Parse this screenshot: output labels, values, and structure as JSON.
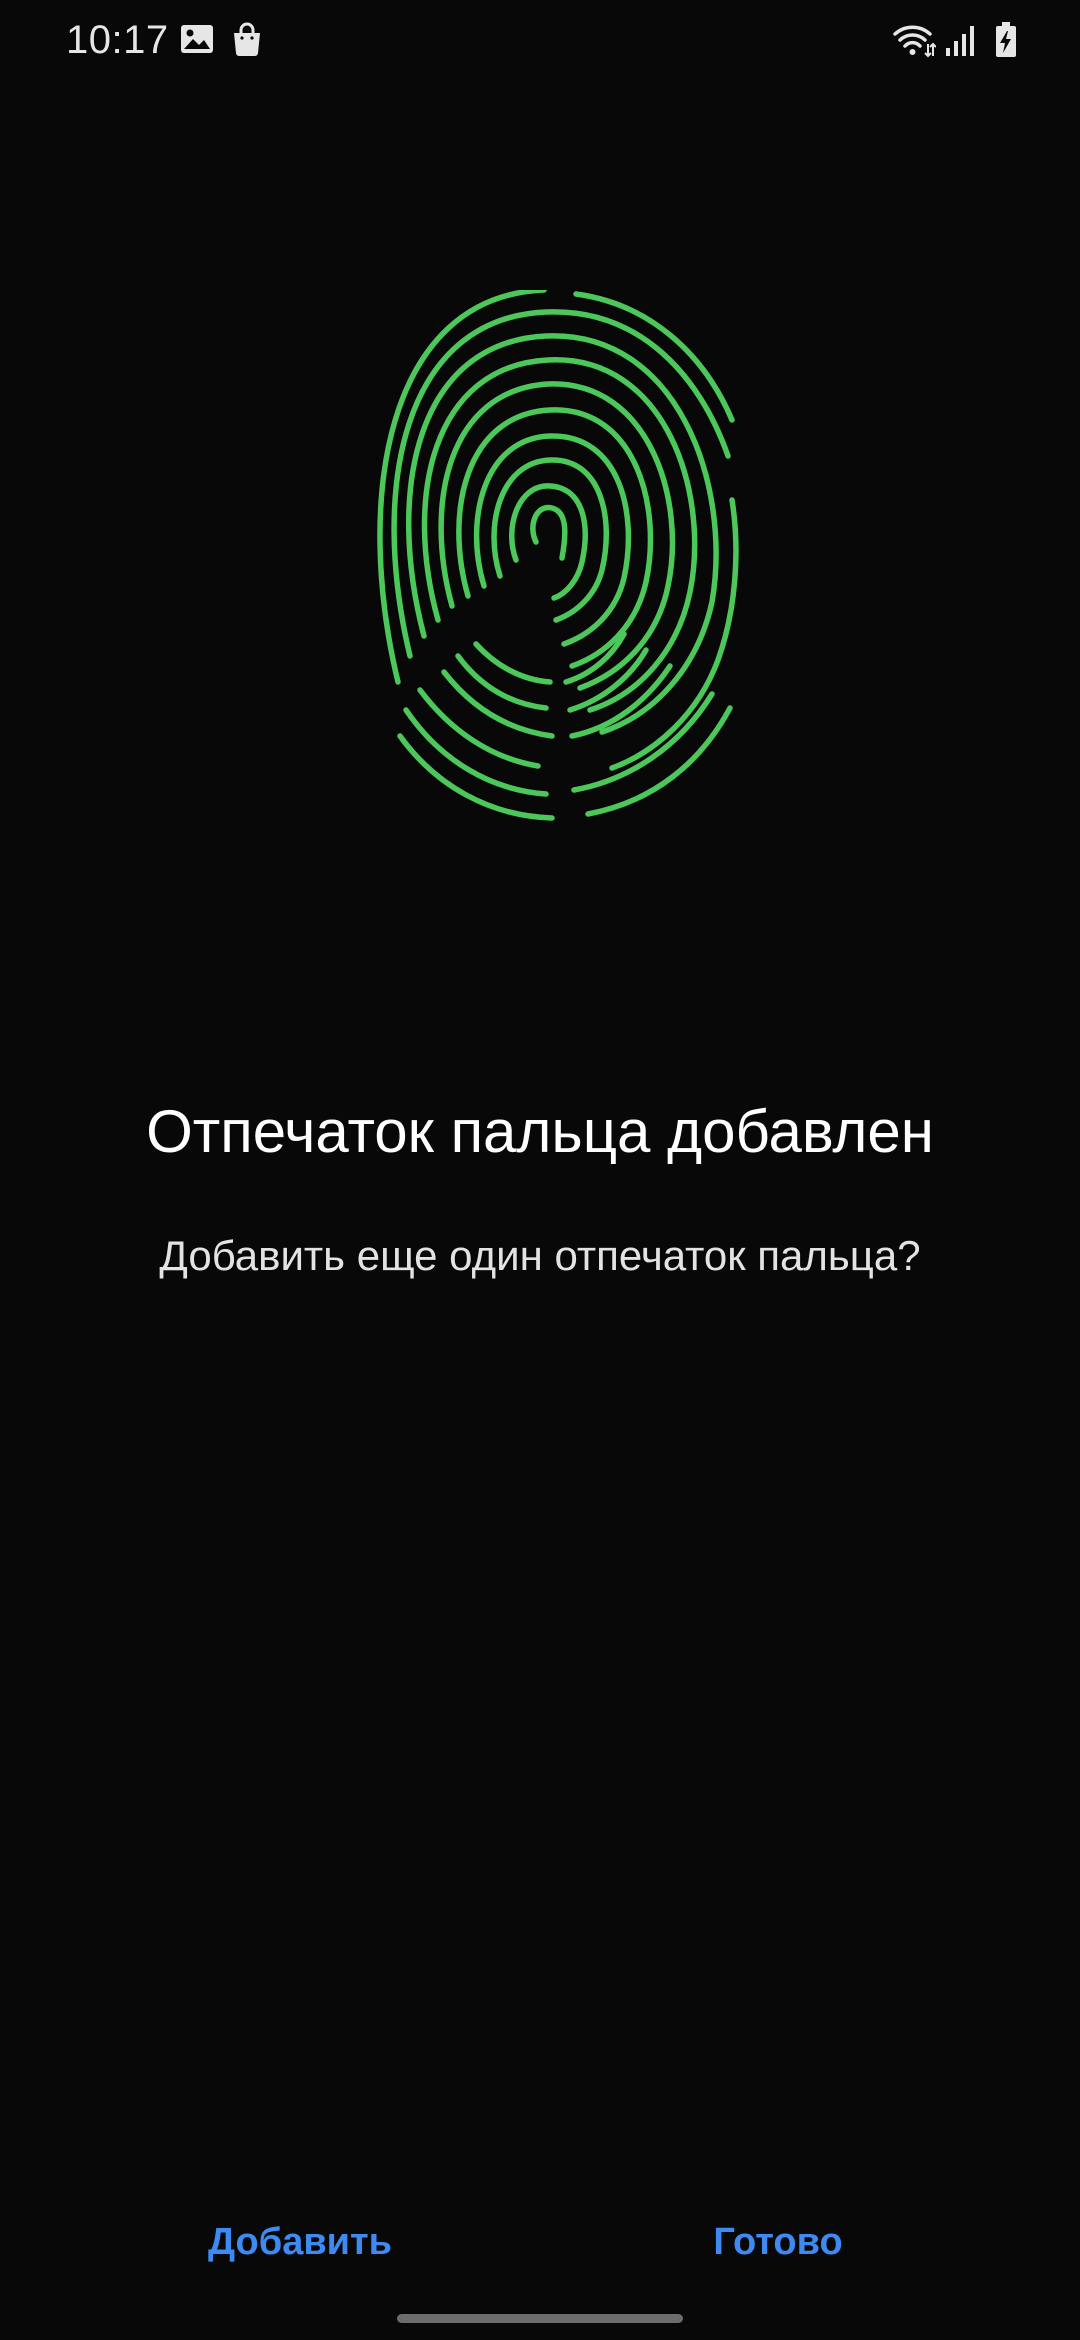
{
  "status_bar": {
    "time": "10:17",
    "icons": [
      "image-icon",
      "shopping-bag-icon",
      "wifi-icon",
      "signal-icon",
      "battery-charging-icon"
    ]
  },
  "fingerprint": {
    "icon": "fingerprint-icon",
    "color": "#4cc75a"
  },
  "main": {
    "title": "Отпечаток пальца добавлен",
    "subtitle": "Добавить еще один отпечаток пальца?"
  },
  "actions": {
    "add_label": "Добавить",
    "done_label": "Готово",
    "accent_color": "#3d8bf2"
  }
}
